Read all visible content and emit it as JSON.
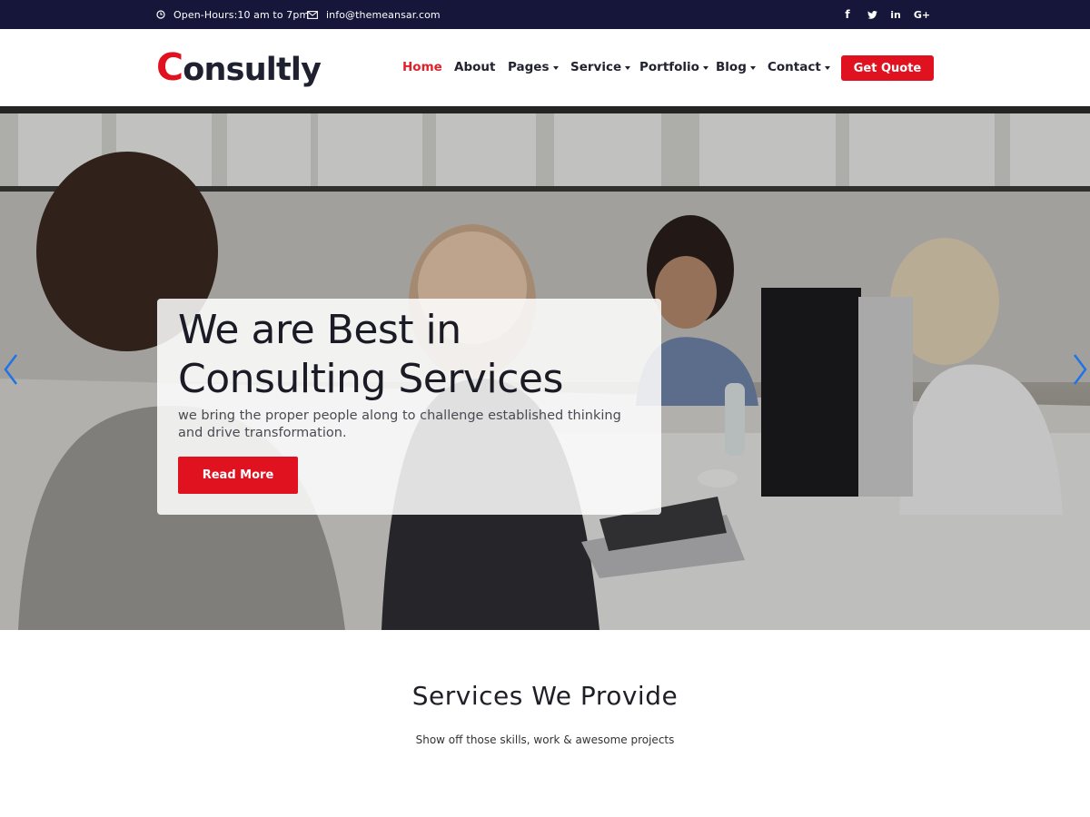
{
  "topbar": {
    "hours": "Open-Hours:10 am to 7pm",
    "email": "info@themeansar.com",
    "hours_icon": "clock-icon",
    "email_icon": "envelope-icon",
    "social": [
      {
        "icon": "facebook-icon",
        "glyph": "f"
      },
      {
        "icon": "twitter-icon",
        "glyph": ""
      },
      {
        "icon": "linkedin-icon",
        "glyph": "in"
      },
      {
        "icon": "google-plus-icon",
        "glyph": "G+"
      }
    ]
  },
  "header": {
    "logo_first": "C",
    "logo_rest": "onsultly",
    "nav": [
      {
        "label": "Home",
        "active": true,
        "dropdown": false
      },
      {
        "label": "About",
        "active": false,
        "dropdown": false
      },
      {
        "label": "Pages",
        "active": false,
        "dropdown": true
      },
      {
        "label": "Service",
        "active": false,
        "dropdown": true
      },
      {
        "label": "Portfolio",
        "active": false,
        "dropdown": true
      },
      {
        "label": "Blog",
        "active": false,
        "dropdown": true
      },
      {
        "label": "Contact",
        "active": false,
        "dropdown": true
      }
    ],
    "cta_label": "Get Quote"
  },
  "hero": {
    "title": "We are Best in Consulting Services",
    "text": "we bring the proper people along to challenge established thinking and drive transformation.",
    "button_label": "Read More",
    "prev_icon": "chevron-left-icon",
    "next_icon": "chevron-right-icon"
  },
  "services": {
    "title": "Services We Provide",
    "subtitle": "Show off those skills, work & awesome projects"
  },
  "colors": {
    "topbar_bg": "#15163a",
    "accent": "#e0121f",
    "nav_text": "#222230",
    "arrow": "#1e73e8"
  }
}
